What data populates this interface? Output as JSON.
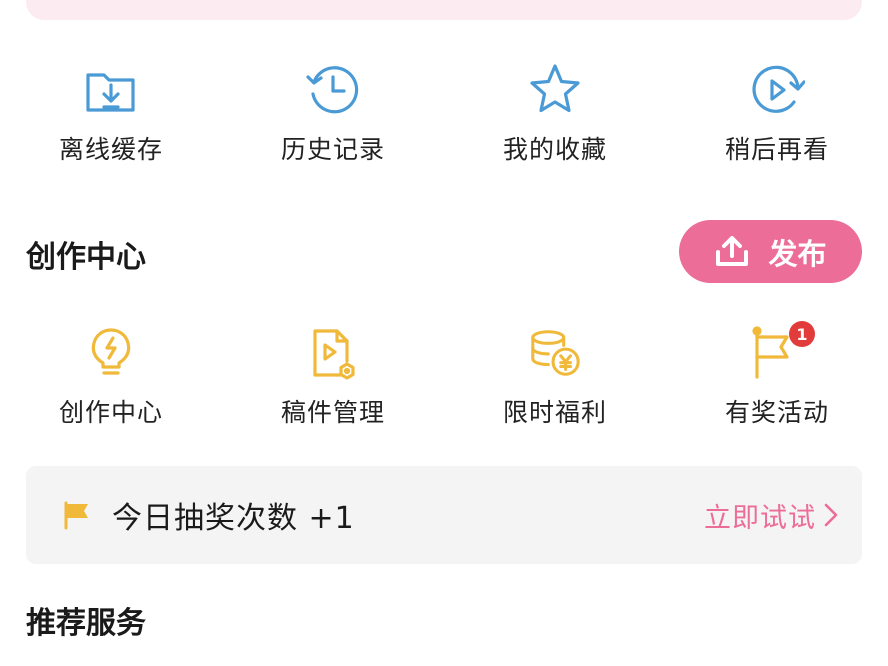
{
  "quick_actions": [
    {
      "label": "离线缓存",
      "icon": "download-folder-icon"
    },
    {
      "label": "历史记录",
      "icon": "history-clock-icon"
    },
    {
      "label": "我的收藏",
      "icon": "star-icon"
    },
    {
      "label": "稍后再看",
      "icon": "watch-later-icon"
    }
  ],
  "creator_section": {
    "title": "创作中心",
    "publish_label": "发布",
    "items": [
      {
        "label": "创作中心",
        "icon": "lightbulb-icon"
      },
      {
        "label": "稿件管理",
        "icon": "manuscript-icon"
      },
      {
        "label": "限时福利",
        "icon": "coins-icon"
      },
      {
        "label": "有奖活动",
        "icon": "flag-icon",
        "badge": "1"
      }
    ]
  },
  "lottery": {
    "text": "今日抽奖次数 +1",
    "action": "立即试试"
  },
  "recommended_title": "推荐服务",
  "colors": {
    "accent_pink": "#ec6e98",
    "blue_icon": "#4a9ad6",
    "yellow_icon": "#f0b93a",
    "badge_red": "#e23b3b"
  }
}
